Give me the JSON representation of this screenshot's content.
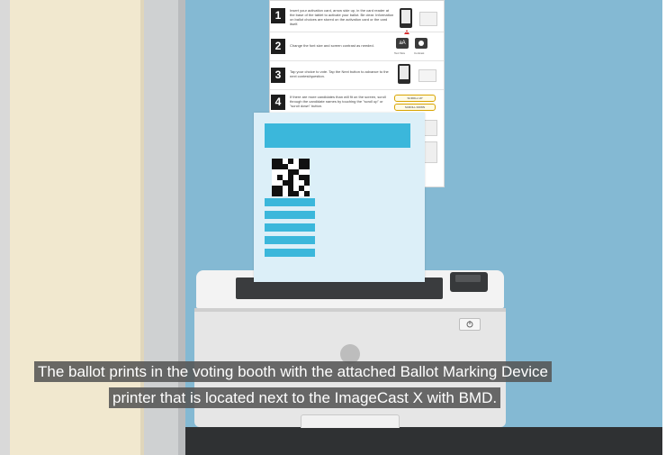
{
  "steps": [
    {
      "num": "1",
      "text": "Insert your activation card, arrow side up, in the card reader at the base of the tablet to activate your ballot. Be clear. Information on ballot choices are stored on the activation card or the card itself."
    },
    {
      "num": "2",
      "text": "Change the font size and screen contrast as needed.",
      "icon_labels": [
        "Text Size",
        "Contrast"
      ]
    },
    {
      "num": "3",
      "text": "Tap your choice to vote. Tap the Next button to advance to the next contest/question."
    },
    {
      "num": "4",
      "text": "If there are more candidates than will fit on the screen, scroll through the candidate names by touching the \"scroll up\" or \"scroll down\" button."
    }
  ],
  "scroll_buttons": [
    "SCROLL UP",
    "SCROLL DOWN"
  ],
  "next_label": "Next",
  "caption": {
    "line1": "The ballot prints in the voting booth with the attached Ballot Marking Device",
    "line2": "printer that is located next to the ImageCast X with BMD."
  },
  "colors": {
    "wall": "#84b9d3",
    "beige_wall": "#f1e8cf",
    "ballot_paper": "#dceff8",
    "ballot_accent": "#3bb7db",
    "printer_body": "#e4e4e4",
    "caption_bg": "#555555"
  },
  "icons": [
    "power-icon",
    "qr-code-icon",
    "tablet-icon",
    "card-reader-icon"
  ]
}
